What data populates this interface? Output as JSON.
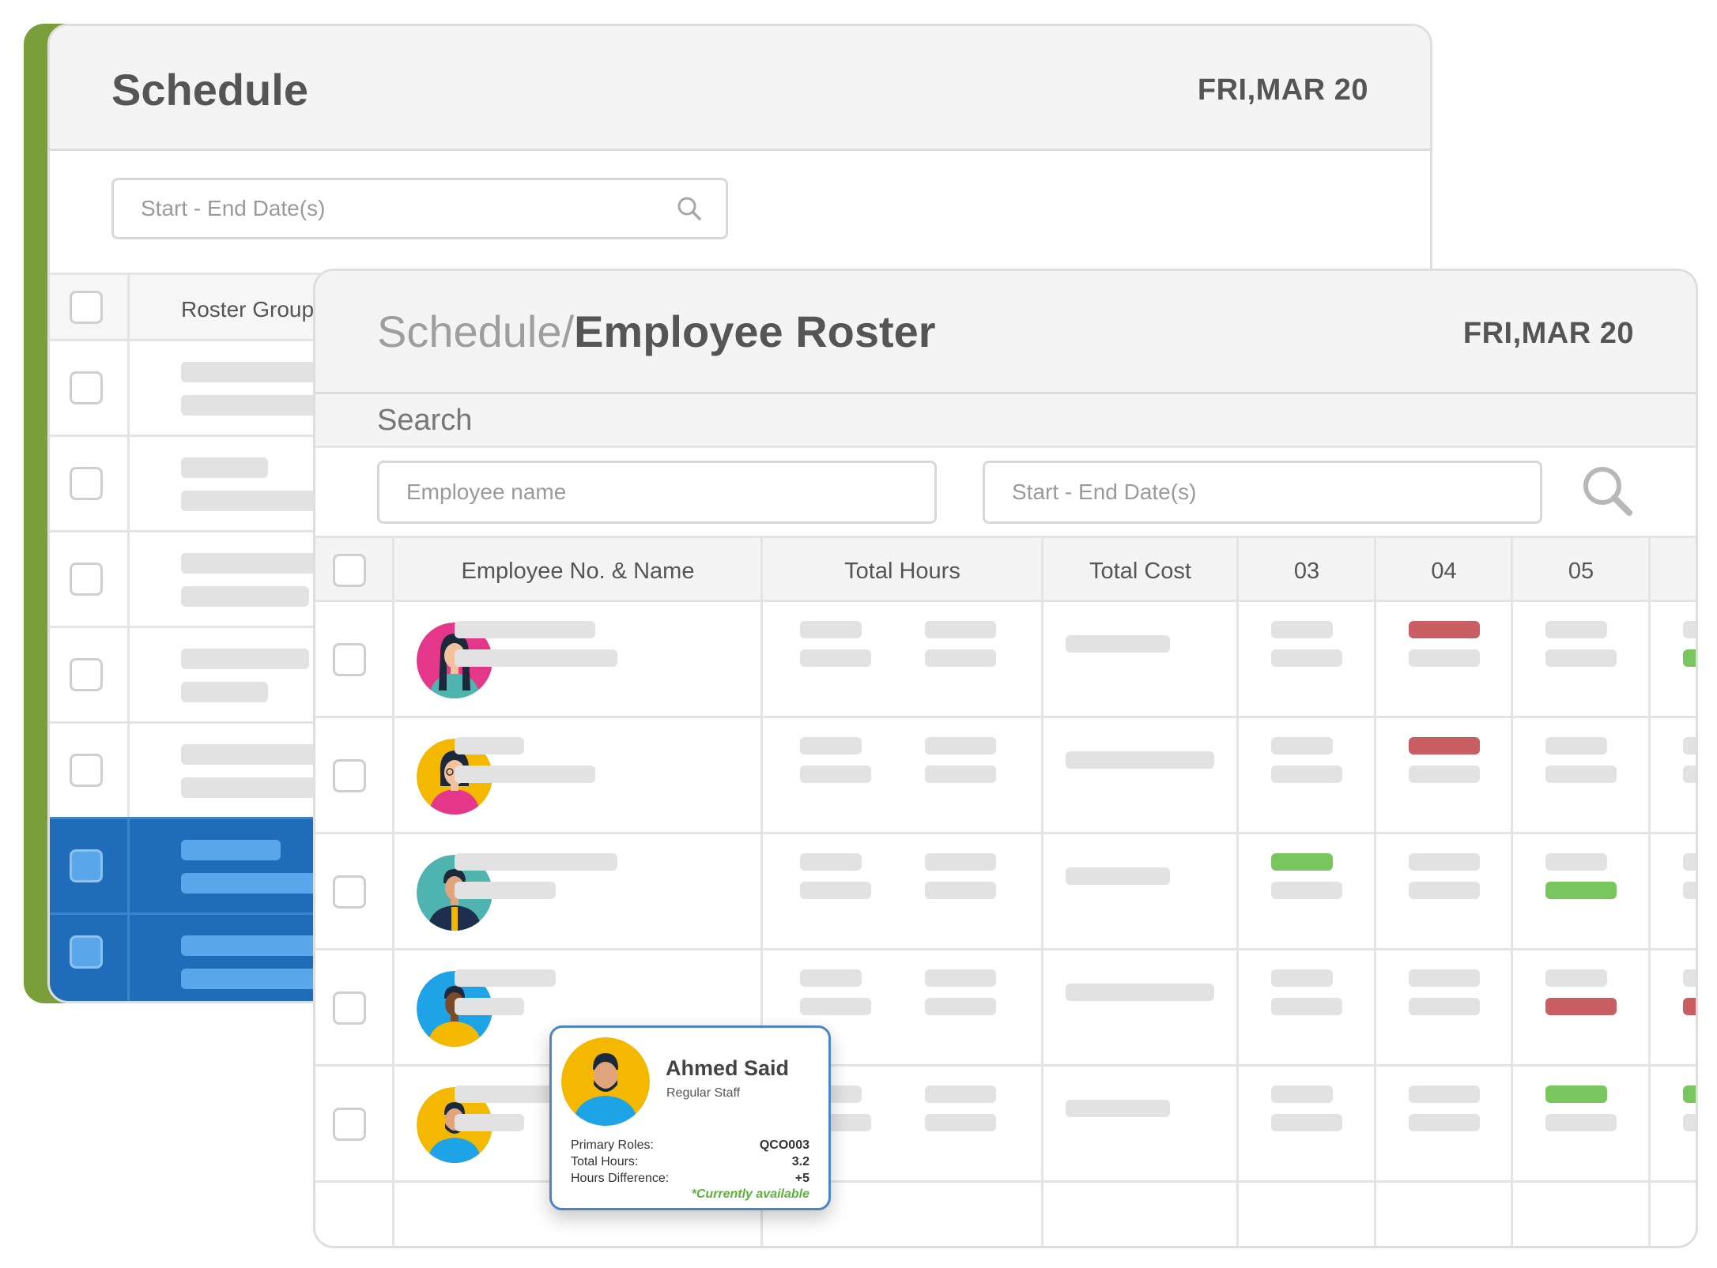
{
  "back_window": {
    "title": "Schedule",
    "date": "FRI,MAR 20",
    "date_range_placeholder": "Start - End Date(s)",
    "column_header": "Roster Group",
    "row_count": 7,
    "selected_rows": [
      5,
      6
    ]
  },
  "front_window": {
    "breadcrumb_parent": "Schedule/",
    "breadcrumb_current": "Employee Roster",
    "date": "FRI,MAR 20",
    "search_label": "Search",
    "employee_name_placeholder": "Employee name",
    "date_range_placeholder": "Start - End Date(s)",
    "columns": [
      "Employee No. & Name",
      "Total Hours",
      "Total Cost",
      "03",
      "04",
      "05"
    ],
    "rows": [
      {
        "avatar": "woman-pink-bg",
        "day_03": "empty",
        "day_04": "red",
        "day_05": "empty",
        "day_06": "green"
      },
      {
        "avatar": "woman-yellow-bg",
        "day_03": "empty",
        "day_04": "red",
        "day_05": "empty",
        "day_06": "empty"
      },
      {
        "avatar": "man-teal-bg",
        "day_03": "green",
        "day_04": "empty",
        "day_05": "green",
        "day_06": "empty"
      },
      {
        "avatar": "man-blue-bg",
        "day_03": "empty",
        "day_04": "empty",
        "day_05": "red",
        "day_06": "red"
      },
      {
        "avatar": "bearded-man-yellow-bg",
        "day_03": "empty",
        "day_04": "empty",
        "day_05": "green",
        "day_06": "green"
      }
    ]
  },
  "employee_card": {
    "name": "Ahmed Said",
    "role": "Regular Staff",
    "primary_roles_label": "Primary Roles:",
    "primary_roles_value": "QCO003",
    "total_hours_label": "Total Hours:",
    "total_hours_value": "3.2",
    "hours_difference_label": "Hours Difference:",
    "hours_difference_value": "+5",
    "status": "*Currently available"
  },
  "colors": {
    "accent_green": "#7a9e3a",
    "selected_blue": "#1f6cb8",
    "shift_red": "#c95f62",
    "shift_green": "#7ac65e",
    "card_border": "#4d86c6"
  }
}
